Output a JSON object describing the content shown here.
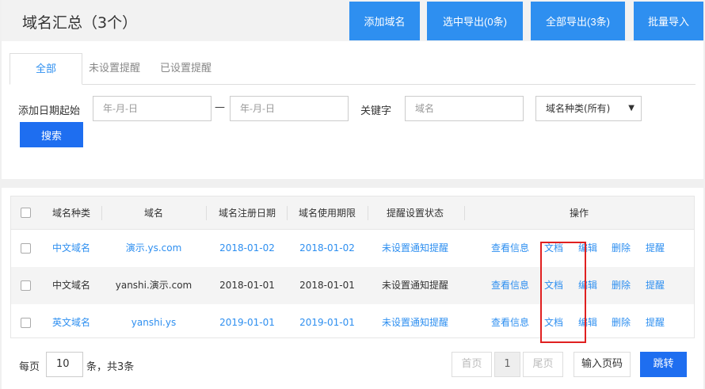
{
  "header": {
    "title": "域名汇总（3个）",
    "buttons": {
      "add": "添加域名",
      "export_selected": "选中导出(0条)",
      "export_all": "全部导出(3条)",
      "import": "批量导入"
    }
  },
  "tabs": [
    "全部",
    "未设置提醒",
    "已设置提醒"
  ],
  "filters": {
    "date_label": "添加日期起始",
    "date_start_placeholder": "年-月-日",
    "date_sep": "—",
    "date_end_placeholder": "年-月-日",
    "keyword_label": "关键字",
    "keyword_placeholder": "域名",
    "type_select": "域名种类(所有)",
    "search_button": "搜索"
  },
  "table": {
    "headers": [
      "域名种类",
      "域名",
      "域名注册日期",
      "域名使用期限",
      "提醒设置状态",
      "操作"
    ],
    "rows": [
      {
        "type": "中文域名",
        "domain": "演示.ys.com",
        "reg": "2018-01-02",
        "exp": "2018-01-02",
        "status": "未设置通知提醒",
        "style": "link"
      },
      {
        "type": "中文域名",
        "domain": "yanshi.演示.com",
        "reg": "2018-01-01",
        "exp": "2018-01-01",
        "status": "未设置通知提醒",
        "style": "dark"
      },
      {
        "type": "英文域名",
        "domain": "yanshi.ys",
        "reg": "2019-01-01",
        "exp": "2019-01-01",
        "status": "未设置通知提醒",
        "style": "link"
      }
    ],
    "actions": [
      "查看信息",
      "文档",
      "编辑",
      "删除",
      "提醒"
    ]
  },
  "pager": {
    "per_page_label": "每页",
    "per_page_value": "10",
    "total_label": "条，共3条",
    "first": "首页",
    "current": "1",
    "last": "尾页",
    "jump_placeholder": "输入页码",
    "jump_button": "跳转"
  },
  "colors": {
    "accent": "#2e8ff0",
    "primary_button": "#1e6ef0",
    "highlight": "#e02020"
  }
}
